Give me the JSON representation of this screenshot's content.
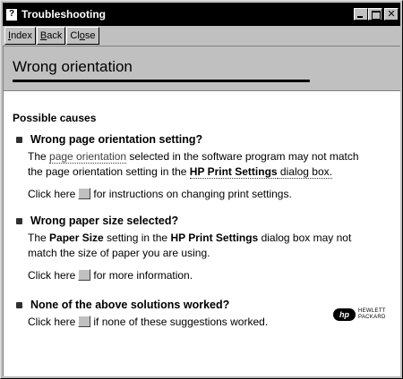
{
  "window": {
    "title": "Troubleshooting",
    "title_icon": "?"
  },
  "toolbar": {
    "index": {
      "ul": "I",
      "rest": "ndex"
    },
    "back": {
      "ul": "B",
      "rest": "ack"
    },
    "close": {
      "pre": "Cl",
      "ul": "o",
      "rest": "se"
    }
  },
  "header": {
    "title": "Wrong orientation"
  },
  "causes_label": "Possible causes",
  "items": [
    {
      "title": "Wrong page orientation setting?",
      "p1a": "The ",
      "p1link": "page orientation",
      "p1b": " selected in the software program may not match",
      "p2a": "the page orientation setting in the ",
      "p2bold": "HP Print Settings",
      "p2b": " dialog box.",
      "clicka": "Click here",
      "clickb": "for instructions on changing print settings."
    },
    {
      "title": "Wrong paper size selected?",
      "p1a": "The ",
      "p1bold": "Paper Size",
      "p1b": " setting in the ",
      "p1bold2": "HP Print Settings",
      "p1c": " dialog box may not",
      "p2": "match the size of paper you are using.",
      "clicka": "Click here",
      "clickb": "for more information."
    },
    {
      "title": "None of the above solutions worked?",
      "clicka": "Click here",
      "clickb": "if none of these suggestions worked."
    }
  ],
  "logo": {
    "mark": "hp",
    "line1": "HEWLETT",
    "line2": "PACKARD"
  }
}
